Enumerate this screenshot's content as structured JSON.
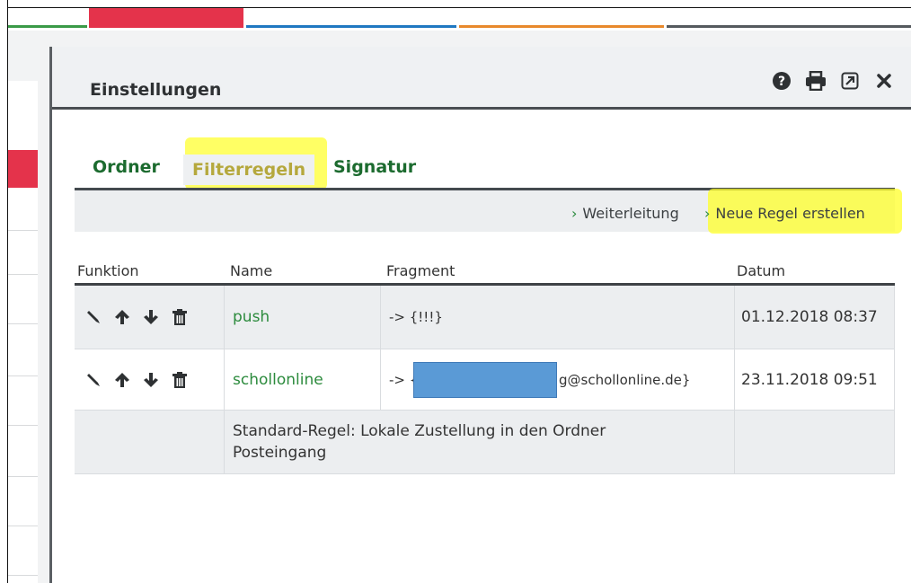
{
  "colors": {
    "strip_green": "#3a9a47",
    "strip_red": "#e4334b",
    "strip_blue": "#1f78c1",
    "strip_orange": "#e8892c",
    "link_green": "#2c8b3d",
    "tab_green": "#1c6b2f",
    "highlight_yellow": "#ffff28",
    "redaction_blue": "#5a9ad6"
  },
  "dialog": {
    "title": "Einstellungen",
    "header_icons": [
      "question-circle-icon",
      "print-icon",
      "external-link-icon",
      "close-icon"
    ]
  },
  "tabs": [
    {
      "label": "Ordner",
      "active": false
    },
    {
      "label": "Filterregeln",
      "active": true
    },
    {
      "label": "Signatur",
      "active": false
    }
  ],
  "actions": {
    "forward_label": "Weiterleitung",
    "new_rule_label": "Neue Regel erstellen"
  },
  "table": {
    "headers": {
      "function": "Funktion",
      "name": "Name",
      "fragment": "Fragment",
      "date": "Datum"
    },
    "function_icons": [
      "edit-pencil-icon",
      "move-up-arrow-icon",
      "move-down-arrow-icon",
      "delete-trash-icon"
    ],
    "rows": [
      {
        "name": "push",
        "fragment": "-> {!!!}",
        "date": "01.12.2018 08:37"
      },
      {
        "name": "schollonline",
        "fragment_prefix": "-> {",
        "fragment_suffix": "g@schollonline.de}",
        "date": "23.11.2018 09:51"
      }
    ],
    "default_rule": "Standard-Regel: Lokale Zustellung in den Ordner Posteingang"
  }
}
